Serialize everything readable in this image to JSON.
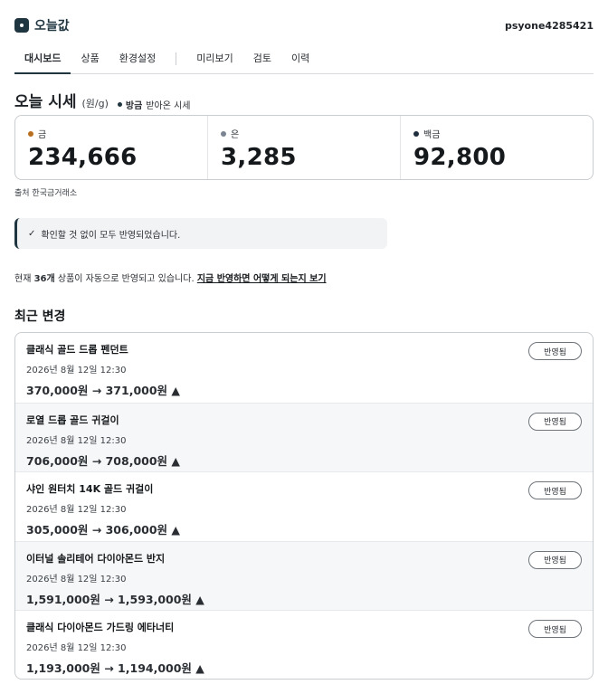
{
  "app": {
    "name": "오늘값",
    "user": "psyone4285421"
  },
  "nav": {
    "tabs": [
      {
        "label": "대시보드",
        "active": true
      },
      {
        "label": "상품",
        "active": false
      },
      {
        "label": "환경설정",
        "active": false
      },
      {
        "label": "미리보기",
        "active": false
      },
      {
        "label": "검토",
        "active": false
      },
      {
        "label": "이력",
        "active": false
      }
    ]
  },
  "prices": {
    "title": "오늘 시세",
    "unit": "(원/g)",
    "live_strong": "방금",
    "live_rest": "받아온 시세",
    "metals": [
      {
        "name": "금",
        "value": "234,666",
        "color": "#b86e1f"
      },
      {
        "name": "은",
        "value": "3,285",
        "color": "#7a8591"
      },
      {
        "name": "백금",
        "value": "92,800",
        "color": "#1f2f3d"
      }
    ],
    "source": "출처 한국금거래소"
  },
  "notice": {
    "icon": "check-icon",
    "text": "확인할 것 없이 모두 반영되었습니다."
  },
  "auto": {
    "prefix": "현재",
    "count": "36개",
    "suffix": "상품이 자동으로 반영되고 있습니다.",
    "link": "지금 반영하면 어떻게 되는지 보기"
  },
  "recent": {
    "title": "최근 변경",
    "items": [
      {
        "name": "클래식 골드 드롭 펜던트",
        "date": "2026년 8월 12일 12:30",
        "change": "370,000원 → 371,000원 ▲",
        "status": "반영됨"
      },
      {
        "name": "로열 드롭 골드 귀걸이",
        "date": "2026년 8월 12일 12:30",
        "change": "706,000원 → 708,000원 ▲",
        "status": "반영됨"
      },
      {
        "name": "샤인 원터치 14K 골드 귀걸이",
        "date": "2026년 8월 12일 12:30",
        "change": "305,000원 → 306,000원 ▲",
        "status": "반영됨"
      },
      {
        "name": "이터널 솔리테어 다이아몬드 반지",
        "date": "2026년 8월 12일 12:30",
        "change": "1,591,000원 → 1,593,000원 ▲",
        "status": "반영됨"
      },
      {
        "name": "클래식 다이아몬드 가드링 에타너티",
        "date": "2026년 8월 12일 12:30",
        "change": "1,193,000원 → 1,194,000원 ▲",
        "status": "반영됨"
      }
    ]
  },
  "colors": {
    "brand": "#1f3540",
    "gold": "#b86e1f",
    "silver": "#7a8591",
    "platinum": "#1f2f3d"
  }
}
